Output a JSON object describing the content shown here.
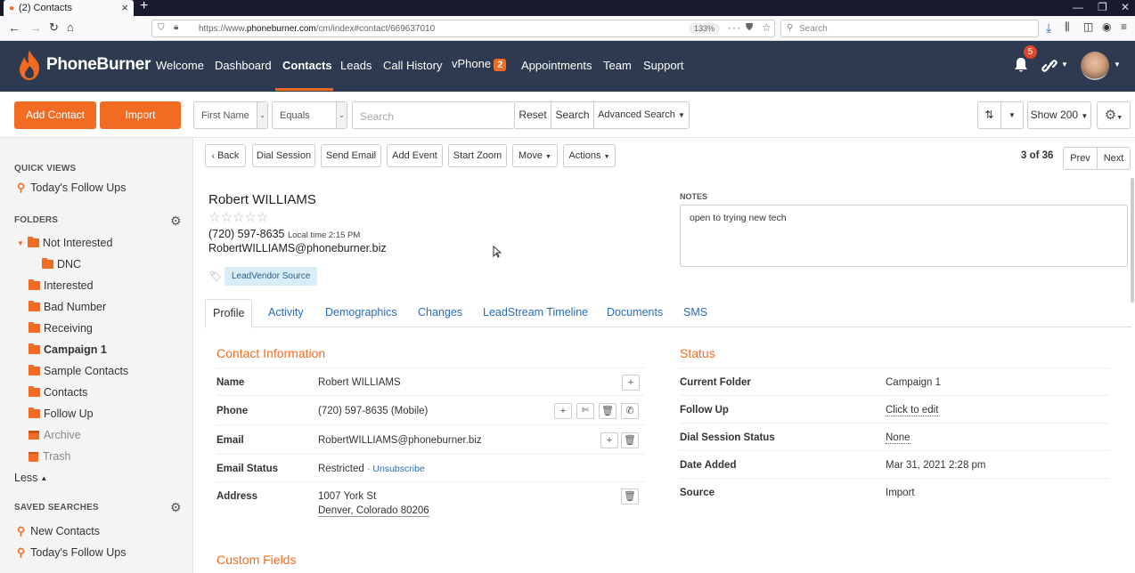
{
  "browser": {
    "tab_title": "(2) Contacts",
    "url_prefix": "https://www.",
    "url_domain": "phoneburner.com",
    "url_path": "/cm/index#contact/669637010",
    "zoom": "133%",
    "search_placeholder": "Search"
  },
  "header": {
    "brand_bold": "PhoneBurner",
    "brand_reg": "",
    "nav": [
      "Welcome",
      "Dashboard",
      "Contacts",
      "Leads",
      "Call History",
      "vPhone",
      "Appointments",
      "Team",
      "Support"
    ],
    "vphone_badge": "2",
    "notif_count": "5"
  },
  "toolbar": {
    "add_contact": "Add Contact",
    "import": "Import",
    "field_select": "First Name",
    "op_select": "Equals",
    "search_placeholder": "Search",
    "reset": "Reset",
    "search": "Search",
    "advanced": "Advanced Search",
    "show": "Show 200"
  },
  "sidebar": {
    "quick_views_title": "QUICK VIEWS",
    "quick_views": [
      "Today's Follow Ups"
    ],
    "folders_title": "FOLDERS",
    "folders": [
      {
        "label": "Not Interested"
      },
      {
        "label": "DNC"
      },
      {
        "label": "Interested"
      },
      {
        "label": "Bad Number"
      },
      {
        "label": "Receiving"
      },
      {
        "label": "Campaign 1"
      },
      {
        "label": "Sample Contacts"
      },
      {
        "label": "Contacts"
      },
      {
        "label": "Follow Up"
      },
      {
        "label": "Archive"
      },
      {
        "label": "Trash"
      }
    ],
    "less": "Less",
    "saved_title": "SAVED SEARCHES",
    "saved": [
      "New Contacts",
      "Today's Follow Ups"
    ]
  },
  "actions": {
    "back": "Back",
    "dial_session": "Dial Session",
    "send_email": "Send Email",
    "add_event": "Add Event",
    "start_zoom": "Start Zoom",
    "move": "Move",
    "actions": "Actions",
    "pager": "3 of 36",
    "prev": "Prev",
    "next": "Next"
  },
  "contact": {
    "name": "Robert WILLIAMS",
    "rating": 0,
    "phone": "(720) 597-8635",
    "local_time": "Local time 2:15 PM",
    "email": "RobertWILLIAMS@phoneburner.biz",
    "tag": "LeadVendor Source",
    "notes_label": "NOTES",
    "notes": "open to trying new tech"
  },
  "tabs": [
    "Profile",
    "Activity",
    "Demographics",
    "Changes",
    "LeadStream Timeline",
    "Documents",
    "SMS"
  ],
  "contact_info": {
    "title": "Contact Information",
    "rows": [
      {
        "label": "Name",
        "value": "Robert WILLIAMS"
      },
      {
        "label": "Phone",
        "value": "(720) 597-8635 (Mobile)"
      },
      {
        "label": "Email",
        "value": "RobertWILLIAMS@phoneburner.biz"
      },
      {
        "label": "Email Status",
        "value": "Restricted",
        "link": "· Unsubscribe"
      },
      {
        "label": "Address",
        "value": "1007 York St",
        "value2": "Denver, Colorado 80206"
      }
    ]
  },
  "status": {
    "title": "Status",
    "rows": [
      {
        "label": "Current Folder",
        "value": "Campaign 1"
      },
      {
        "label": "Follow Up",
        "value": "Click to edit"
      },
      {
        "label": "Dial Session Status",
        "value": "None"
      },
      {
        "label": "Date Added",
        "value": "Mar 31, 2021 2:28 pm"
      },
      {
        "label": "Source",
        "value": "Import"
      }
    ]
  },
  "custom_fields_title": "Custom Fields",
  "colors": {
    "brand_orange": "#f26b22",
    "header_bg": "#2d3a4f",
    "link_blue": "#2a6db5"
  }
}
